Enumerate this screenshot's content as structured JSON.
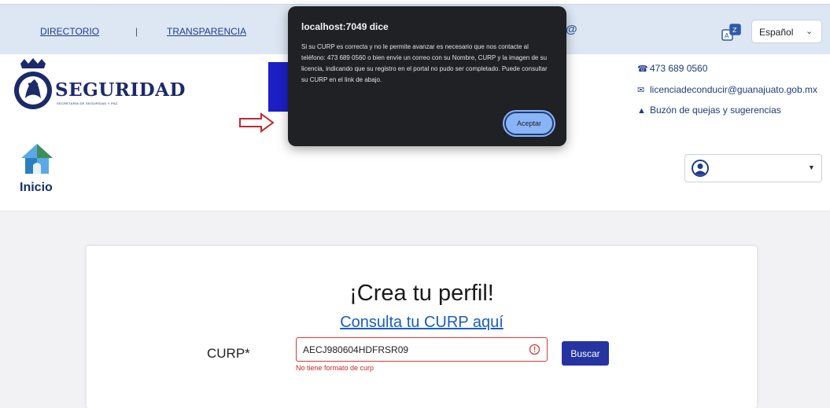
{
  "topbar": {
    "link_directorio": "DIRECTORIO",
    "separator": "|",
    "link_transparencia": "TRANSPARENCIA",
    "language": "Español"
  },
  "logo": {
    "title": "SEGURIDAD",
    "subtitle": "SECRETARÍA DE SEGURIDAD Y PAZ"
  },
  "contact": {
    "phone": "473 689 0560",
    "email": "licenciadeconducir@guanajuato.gob.mx",
    "complaints": "Buzón de quejas y sugerencias"
  },
  "nav": {
    "home_label": "Inicio"
  },
  "form": {
    "title": "¡Crea tu perfil!",
    "consult_link": "Consulta tu CURP aquí",
    "curp_label": "CURP*",
    "curp_value": "AECJ980604HDFRSR09",
    "error_text": "No tiene formato de curp",
    "search_button": "Buscar"
  },
  "dialog": {
    "title": "localhost:7049 dice",
    "message": "Si su CURP es correcta y no le permite avanzar es necesario que nos contacte al teléfono: 473 689 0560 o bien envíe un correo con su Nombre, CURP y la imagen de su licencia, indicando que su registro en el portal no pudo ser completado. Puede consultar su CURP en el link de abajo.",
    "accept_button": "Aceptar"
  },
  "colors": {
    "topbar_bg": "#dde7f3",
    "brand_navy": "#1c2a6b",
    "button_blue": "#2534a0",
    "error_red": "#d63a3a",
    "dialog_bg": "#202124",
    "dialog_button": "#8ab4f8"
  },
  "icons": {
    "threads": "threads-icon",
    "translate": "translate-icon",
    "phone": "phone-icon",
    "email": "envelope-icon",
    "complaints": "thumbs-up-icon",
    "home": "home-icon",
    "user": "user-avatar-icon",
    "arrow": "arrow-right-icon",
    "error": "error-icon"
  }
}
